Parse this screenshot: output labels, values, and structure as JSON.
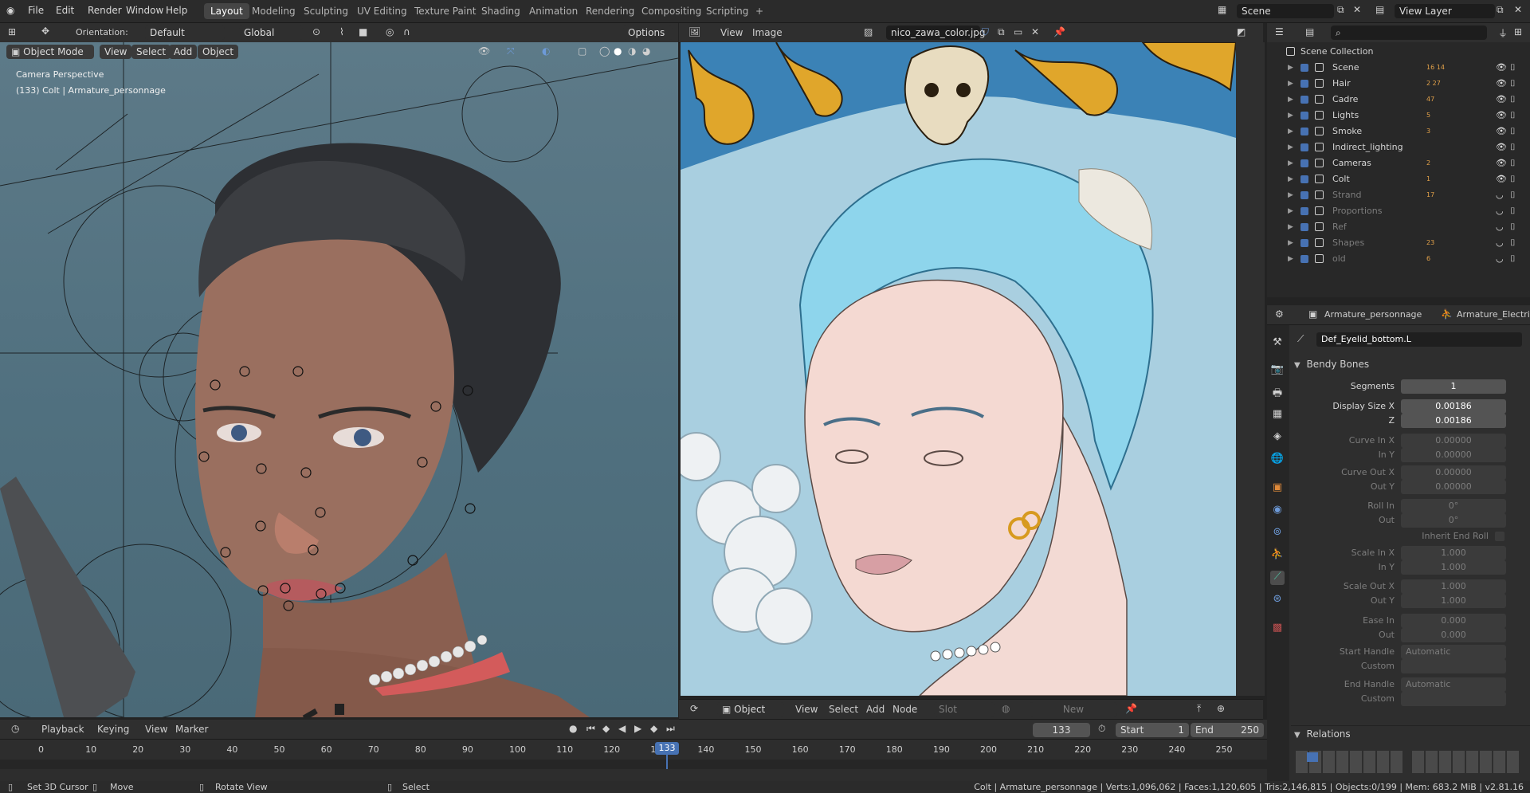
{
  "top_menu": [
    "File",
    "Edit",
    "Render",
    "Window",
    "Help"
  ],
  "workspaces": [
    "Layout",
    "Modeling",
    "Sculpting",
    "UV Editing",
    "Texture Paint",
    "Shading",
    "Animation",
    "Rendering",
    "Compositing",
    "Scripting"
  ],
  "active_workspace": "Layout",
  "add_workspace": "+",
  "scene_name": "Scene",
  "view_layer": "View Layer",
  "viewport": {
    "orientation_label": "Orientation:",
    "orientation_value": "Default",
    "transform_space": "Global",
    "options": "Options",
    "mode": "Object Mode",
    "menus": [
      "View",
      "Select",
      "Add",
      "Object"
    ],
    "overlay_title": "Camera Perspective",
    "overlay_subtitle": "(133) Colt | Armature_personnage"
  },
  "image_editor": {
    "menus": [
      "View",
      "Image"
    ],
    "image_name": "nico_zawa_color.jpg"
  },
  "node_header": {
    "type": "Object",
    "menus": [
      "View",
      "Select",
      "Add",
      "Node"
    ],
    "slot": "Slot",
    "new": "New"
  },
  "outliner": {
    "search_placeholder": "",
    "root": "Scene Collection",
    "collections": [
      {
        "name": "Scene",
        "visible": true,
        "counts": "16 14"
      },
      {
        "name": "Hair",
        "visible": true,
        "counts": "2 27"
      },
      {
        "name": "Cadre",
        "visible": true,
        "counts": "47"
      },
      {
        "name": "Lights",
        "visible": true,
        "counts": "5"
      },
      {
        "name": "Smoke",
        "visible": true,
        "counts": "3"
      },
      {
        "name": "Indirect_lighting",
        "visible": true,
        "counts": ""
      },
      {
        "name": "Cameras",
        "visible": true,
        "counts": "2"
      },
      {
        "name": "Colt",
        "visible": true,
        "counts": "1"
      },
      {
        "name": "Strand",
        "visible": false,
        "counts": "17"
      },
      {
        "name": "Proportions",
        "visible": false,
        "counts": ""
      },
      {
        "name": "Ref",
        "visible": false,
        "counts": ""
      },
      {
        "name": "Shapes",
        "visible": false,
        "counts": "23"
      },
      {
        "name": "old",
        "visible": false,
        "counts": "6"
      }
    ]
  },
  "properties": {
    "object": "Armature_personnage",
    "data": "Armature_Electric",
    "bone": "Def_Eyelid_bottom.L",
    "section": "Bendy Bones",
    "rows": [
      {
        "label": "Segments",
        "value": "1",
        "dim": false
      },
      {
        "label": "Display Size X",
        "value": "0.00186",
        "dim": false
      },
      {
        "label": "Z",
        "value": "0.00186",
        "dim": false
      },
      {
        "label": "Curve In X",
        "value": "0.00000",
        "dim": true
      },
      {
        "label": "In Y",
        "value": "0.00000",
        "dim": true
      },
      {
        "label": "Curve Out X",
        "value": "0.00000",
        "dim": true
      },
      {
        "label": "Out Y",
        "value": "0.00000",
        "dim": true
      },
      {
        "label": "Roll In",
        "value": "0°",
        "dim": true
      },
      {
        "label": "Out",
        "value": "0°",
        "dim": true
      },
      {
        "label": "Inherit End Roll",
        "value": "",
        "dim": true
      },
      {
        "label": "Scale In X",
        "value": "1.000",
        "dim": true
      },
      {
        "label": "In Y",
        "value": "1.000",
        "dim": true
      },
      {
        "label": "Scale Out X",
        "value": "1.000",
        "dim": true
      },
      {
        "label": "Out Y",
        "value": "1.000",
        "dim": true
      },
      {
        "label": "Ease In",
        "value": "0.000",
        "dim": true
      },
      {
        "label": "Out",
        "value": "0.000",
        "dim": true
      },
      {
        "label": "Start Handle",
        "value": "Automatic",
        "dim": true
      },
      {
        "label": "Custom",
        "value": "",
        "dim": true
      },
      {
        "label": "End Handle",
        "value": "Automatic",
        "dim": true
      },
      {
        "label": "Custom",
        "value": "",
        "dim": true
      }
    ],
    "relations": "Relations"
  },
  "timeline": {
    "menus": [
      "Playback",
      "Keying",
      "View",
      "Marker"
    ],
    "current_frame": "133",
    "start_label": "Start",
    "start": "1",
    "end_label": "End",
    "end": "250",
    "ticks": [
      "0",
      "10",
      "20",
      "30",
      "40",
      "50",
      "60",
      "70",
      "80",
      "90",
      "100",
      "110",
      "120",
      "13",
      "140",
      "150",
      "160",
      "170",
      "180",
      "190",
      "200",
      "210",
      "220",
      "230",
      "240",
      "250"
    ]
  },
  "status": {
    "left": [
      "Set 3D Cursor",
      "Move",
      "Rotate View",
      "Select"
    ],
    "right": "Colt | Armature_personnage | Verts:1,096,062 | Faces:1,120,605 | Tris:2,146,815 | Objects:0/199 | Mem: 683.2 MiB | v2.81.16"
  },
  "colors": {
    "accent": "#4772b3",
    "active_frame": "#4772b3",
    "viewport_bg": "#55747f"
  }
}
